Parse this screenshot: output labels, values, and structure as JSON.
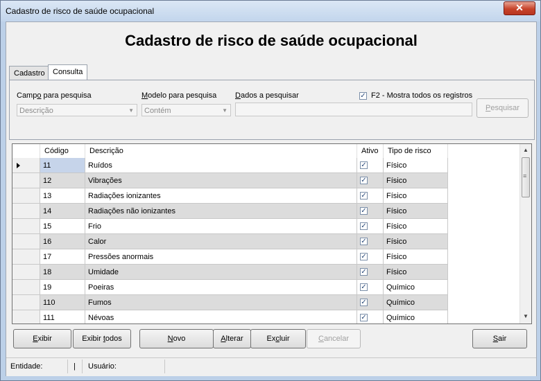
{
  "window": {
    "title": "Cadastro de risco de saúde ocupacional",
    "close_symbol": "✕"
  },
  "heading": "Cadastro de risco de saúde ocupacional",
  "tabs": [
    {
      "label": "Cadastro"
    },
    {
      "label": "Consulta",
      "active": true
    }
  ],
  "search": {
    "campo_label_pre": "Camp",
    "campo_label_ul": "o",
    "campo_label_post": " para pesquisa",
    "campo_value": "Descrição",
    "modelo_label_ul": "M",
    "modelo_label_post": "odelo para pesquisa",
    "modelo_value": "Contém",
    "dados_label_ul": "D",
    "dados_label_post": "ados a pesquisar",
    "dados_value": "",
    "f2_label": "F2 - Mostra todos os registros",
    "f2_checked": true,
    "pesquisar_label_ul": "P",
    "pesquisar_label_post": "esquisar"
  },
  "grid": {
    "columns": [
      "Código",
      "Descrição",
      "Ativo",
      "Tipo de risco"
    ],
    "rows": [
      {
        "codigo": "11",
        "descricao": "Ruídos",
        "ativo": true,
        "tipo": "Físico",
        "current": true
      },
      {
        "codigo": "12",
        "descricao": "Vibrações",
        "ativo": true,
        "tipo": "Físico"
      },
      {
        "codigo": "13",
        "descricao": "Radiações ionizantes",
        "ativo": true,
        "tipo": "Físico"
      },
      {
        "codigo": "14",
        "descricao": "Radiações não ionizantes",
        "ativo": true,
        "tipo": "Físico"
      },
      {
        "codigo": "15",
        "descricao": "Frio",
        "ativo": true,
        "tipo": "Físico"
      },
      {
        "codigo": "16",
        "descricao": "Calor",
        "ativo": true,
        "tipo": "Físico"
      },
      {
        "codigo": "17",
        "descricao": "Pressões anormais",
        "ativo": true,
        "tipo": "Físico"
      },
      {
        "codigo": "18",
        "descricao": "Umidade",
        "ativo": true,
        "tipo": "Físico"
      },
      {
        "codigo": "19",
        "descricao": "Poeiras",
        "ativo": true,
        "tipo": "Químico"
      },
      {
        "codigo": "110",
        "descricao": "Fumos",
        "ativo": true,
        "tipo": "Químico"
      },
      {
        "codigo": "111",
        "descricao": "Névoas",
        "ativo": true,
        "tipo": "Químico"
      }
    ]
  },
  "buttons": {
    "exibir": {
      "ul": "E",
      "post": "xibir"
    },
    "exibir_todos": {
      "pre": "Exibir ",
      "ul": "t",
      "post": "odos"
    },
    "novo": {
      "ul": "N",
      "post": "ovo"
    },
    "alterar": {
      "ul": "A",
      "post": "lterar"
    },
    "excluir": {
      "pre": "Ex",
      "ul": "c",
      "post": "luir"
    },
    "cancelar": {
      "ul": "C",
      "post": "ancelar"
    },
    "sair": {
      "ul": "S",
      "post": "air"
    }
  },
  "status": {
    "entidade_label": "Entidade:",
    "sep": "|",
    "usuario_label": "Usuário:"
  },
  "icons": {
    "current_row": "triangle-right",
    "check": "check-mark",
    "scroll_up": "▲",
    "scroll_down": "▼",
    "grip": "≡"
  },
  "colors": {
    "row_alt": "#dcdcdc",
    "row_base": "#ffffff",
    "code_highlight": "#c6d4ea",
    "title_bar": "#c2d5ec",
    "close_button": "#c7432a"
  }
}
